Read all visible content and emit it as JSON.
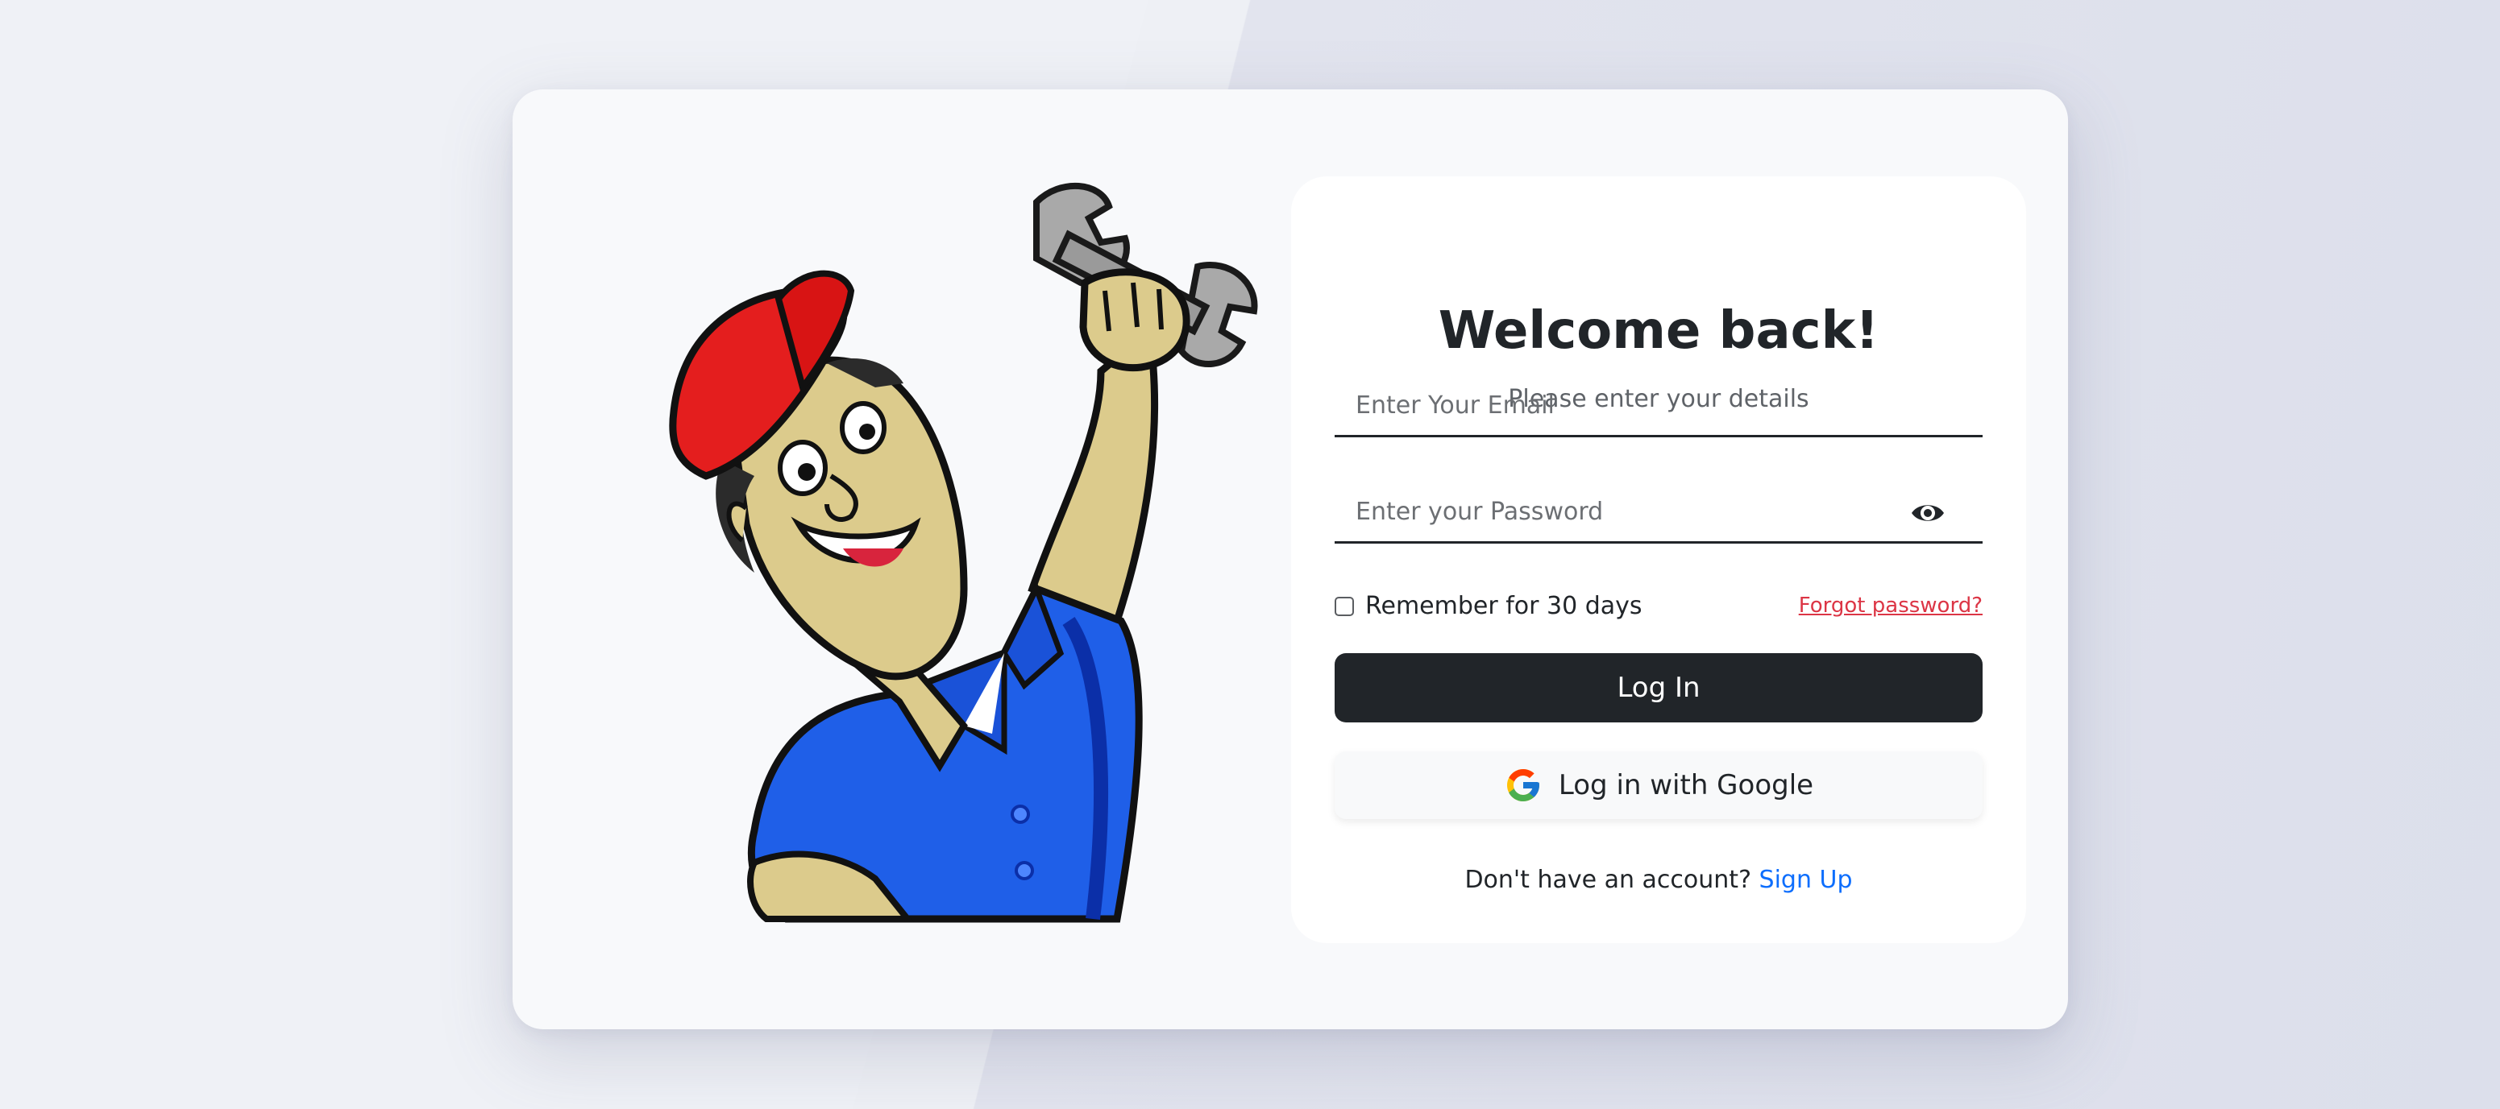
{
  "login": {
    "title": "Welcome back!",
    "subtitle": "Please enter your details",
    "email_placeholder": "Enter Your Email",
    "password_placeholder": "Enter your Password",
    "remember_label": "Remember for 30 days",
    "forgot_label": "Forgot password?",
    "login_button": "Log In",
    "google_button": "Log in with Google",
    "signup_prompt": "Don't have an account?",
    "signup_link": "Sign Up"
  },
  "icons": {
    "password_toggle": "eye-icon",
    "google": "google-logo-icon",
    "illustration": "mechanic-illustration"
  },
  "colors": {
    "primary_button": "#212529",
    "forgot_link": "#dc3545",
    "signup_link": "#0d6efd"
  }
}
